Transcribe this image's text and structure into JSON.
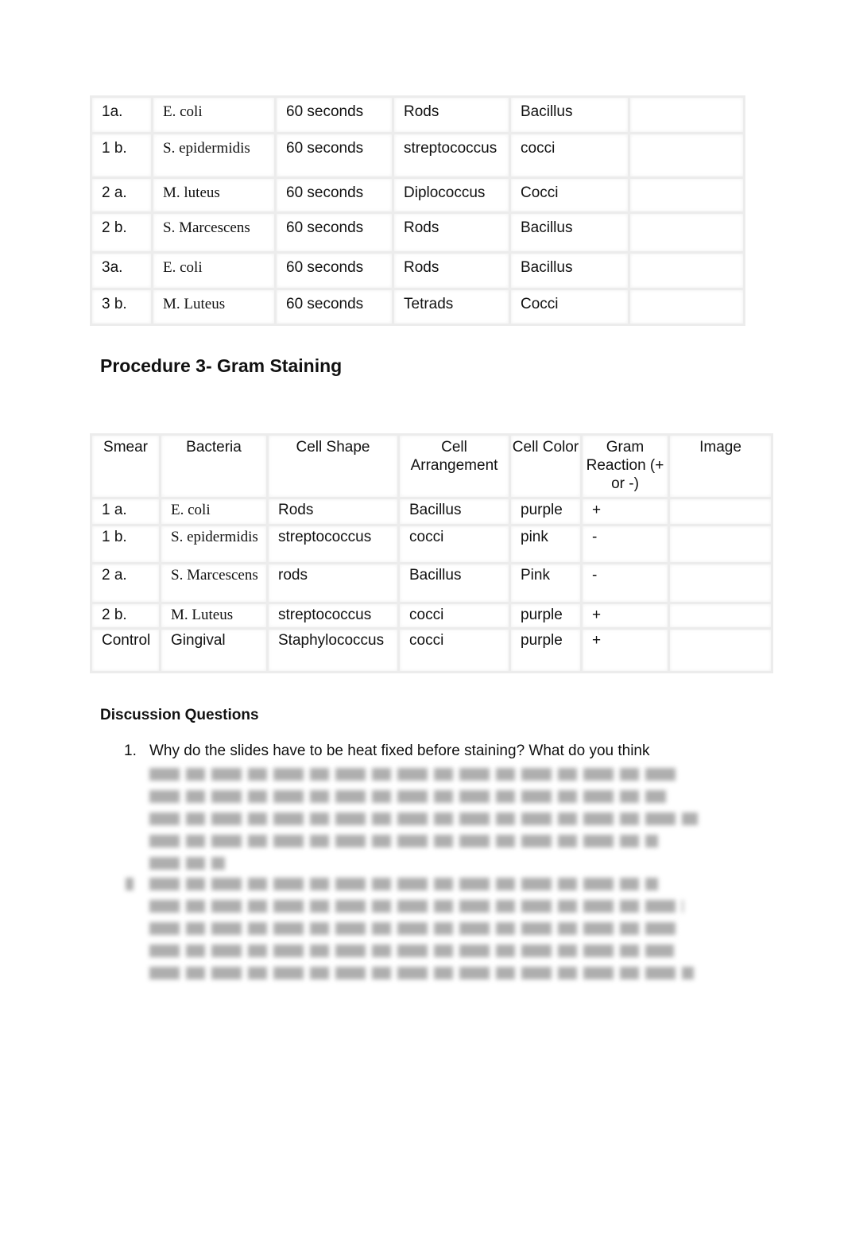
{
  "table1": {
    "rows": [
      [
        "1a.",
        "E. coli",
        "60 seconds",
        "Rods",
        "Bacillus",
        ""
      ],
      [
        "1 b.",
        "S. epidermidis",
        "60 seconds",
        "streptococcus",
        "cocci",
        ""
      ],
      [
        "2 a.",
        "M. luteus",
        "60 seconds",
        "Diplococcus",
        "Cocci",
        ""
      ],
      [
        "2 b.",
        "S. Marcescens",
        "60 seconds",
        "Rods",
        "Bacillus",
        ""
      ],
      [
        "3a.",
        "E. coli",
        "60 seconds",
        "Rods",
        "Bacillus",
        ""
      ],
      [
        "3 b.",
        "M. Luteus",
        "60 seconds",
        "Tetrads",
        "Cocci",
        ""
      ]
    ]
  },
  "procedure3_title": "Procedure 3- Gram Staining",
  "table2": {
    "headers": [
      "Smear",
      "Bacteria",
      "Cell Shape",
      "Cell Arrangement",
      "Cell Color",
      "Gram Reaction (+ or -)",
      "Image"
    ],
    "rows": [
      [
        "1 a.",
        "E. coli",
        "Rods",
        "Bacillus",
        "purple",
        "+",
        ""
      ],
      [
        "1 b.",
        "S. epidermidis",
        "streptococcus",
        "cocci",
        "pink",
        "-",
        ""
      ],
      [
        "2 a.",
        "S. Marcescens",
        "rods",
        "Bacillus",
        "Pink",
        "-",
        ""
      ],
      [
        "2 b.",
        "M. Luteus",
        "streptococcus",
        "cocci",
        "purple",
        "+",
        ""
      ],
      [
        "Control",
        "Gingival",
        "Staphylococcus",
        "cocci",
        "purple",
        "+",
        ""
      ]
    ]
  },
  "discussion": {
    "title": "Discussion Questions",
    "q1_number": "1.",
    "q1_text": "Why do the slides have to be heat fixed before staining? What do you think"
  }
}
